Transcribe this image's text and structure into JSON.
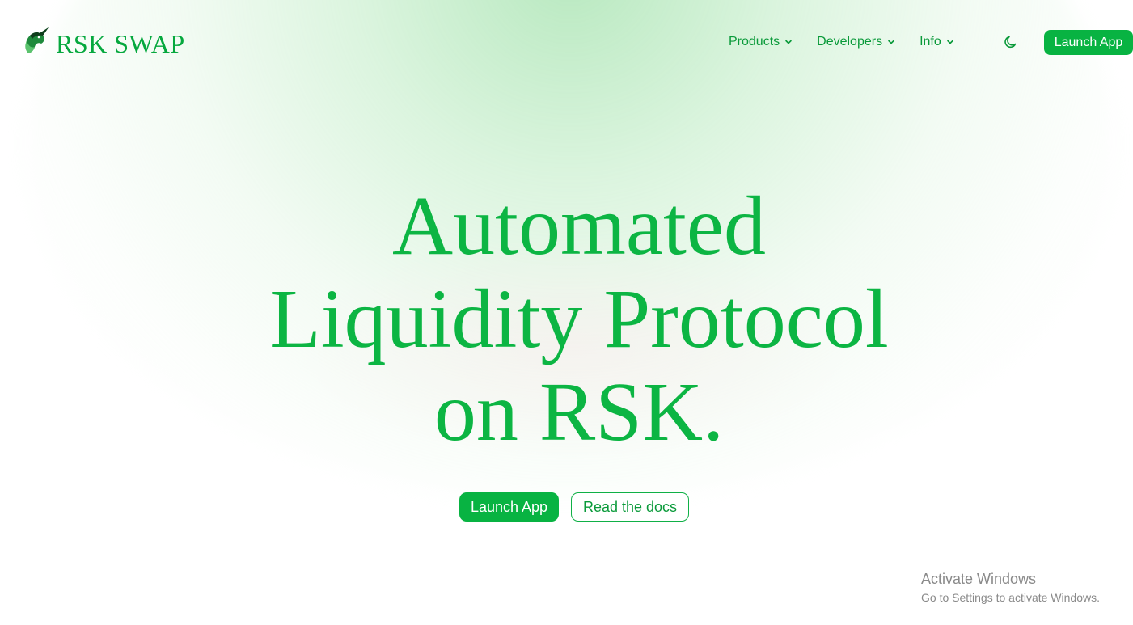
{
  "brand": {
    "name": "RSK SWAP",
    "accent_color": "#08b342",
    "logo_icon": "unicorn-head-icon"
  },
  "nav": {
    "items": [
      {
        "label": "Products",
        "icon": "chevron-down-icon"
      },
      {
        "label": "Developers",
        "icon": "chevron-down-icon"
      },
      {
        "label": "Info",
        "icon": "chevron-down-icon"
      }
    ],
    "theme_toggle_icon": "moon-icon",
    "launch_label": "Launch App"
  },
  "hero": {
    "title_lines": [
      "Automated",
      "Liquidity Protocol",
      "on RSK."
    ],
    "primary_cta": "Launch App",
    "secondary_cta": "Read the docs"
  },
  "os_watermark": {
    "title": "Activate Windows",
    "subtitle": "Go to Settings to activate Windows."
  }
}
